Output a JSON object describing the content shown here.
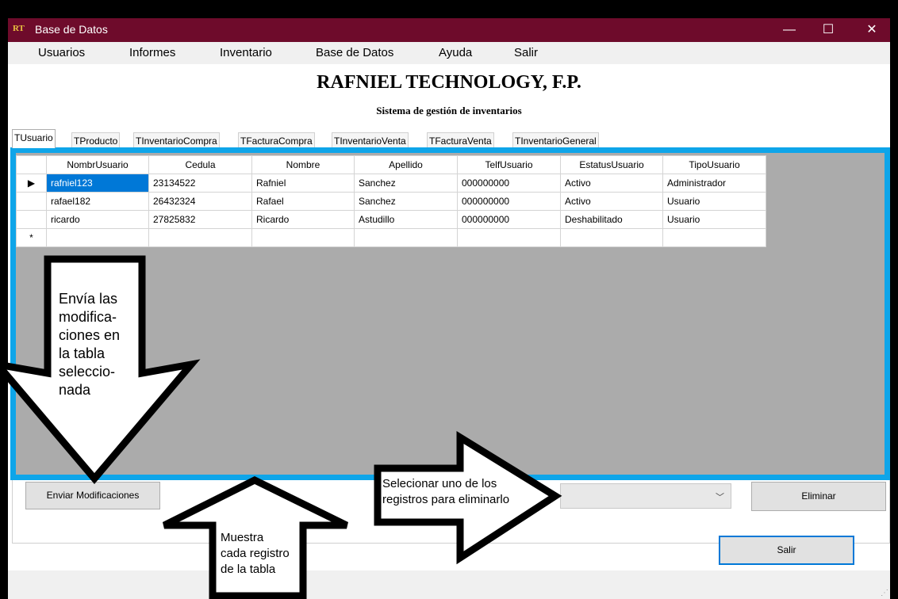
{
  "window": {
    "icon_text": "RT",
    "title": "Base de Datos",
    "controls": {
      "minimize": "—",
      "maximize": "☐",
      "close": "✕"
    }
  },
  "menu": [
    "Usuarios",
    "Informes",
    "Inventario",
    "Base de Datos",
    "Ayuda",
    "Salir"
  ],
  "header": {
    "title": "RAFNIEL TECHNOLOGY, F.P.",
    "subtitle": "Sistema de gestión de inventarios"
  },
  "tabs": [
    "TUsuario",
    "TProducto",
    "TInventarioCompra",
    "TFacturaCompra",
    "TInventarioVenta",
    "TFacturaVenta",
    "TInventarioGeneral"
  ],
  "active_tab": "TUsuario",
  "grid": {
    "columns": [
      "NombrUsuario",
      "Cedula",
      "Nombre",
      "Apellido",
      "TelfUsuario",
      "EstatusUsuario",
      "TipoUsuario"
    ],
    "rows": [
      {
        "indicator": "▶",
        "cells": [
          "rafniel123",
          "23134522",
          "Rafniel",
          "Sanchez",
          "000000000",
          "Activo",
          "Administrador"
        ]
      },
      {
        "indicator": "",
        "cells": [
          "rafael182",
          "26432324",
          "Rafael",
          "Sanchez",
          "000000000",
          "Activo",
          "Usuario"
        ]
      },
      {
        "indicator": "",
        "cells": [
          "ricardo",
          "27825832",
          "Ricardo",
          "Astudillo",
          "000000000",
          "Deshabilitado",
          "Usuario"
        ]
      }
    ],
    "new_row_indicator": "*"
  },
  "buttons": {
    "send": "Enviar Modificaciones",
    "delete": "Eliminar",
    "exit": "Salir"
  },
  "combo": {
    "value": "",
    "arrow": "﹀"
  },
  "annotations": {
    "arrow_send": [
      "Envía las",
      "modifica-",
      "ciones en",
      "la tabla",
      "seleccio-",
      "nada"
    ],
    "arrow_show": [
      "Muestra",
      "cada registro",
      "de la tabla"
    ],
    "arrow_select": [
      "Selecionar uno de los",
      "registros para eliminarlo"
    ]
  },
  "colors": {
    "titlebar": "#6e0b2b",
    "grid_frame": "#0ea5e9",
    "grid_background": "#ababab",
    "selection": "#0078d7"
  }
}
